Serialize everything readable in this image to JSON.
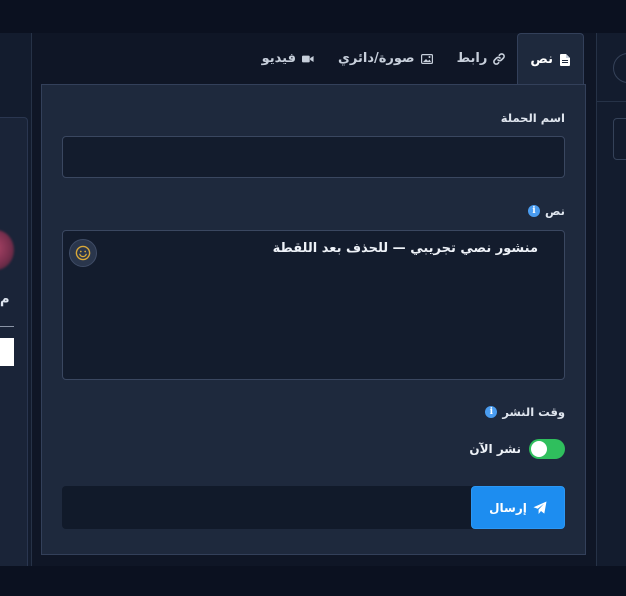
{
  "tabs": [
    {
      "label": "نص",
      "icon": "file-icon",
      "active": true
    },
    {
      "label": "رابط",
      "icon": "link-icon",
      "active": false
    },
    {
      "label": "صورة/دائري",
      "icon": "image-icon",
      "active": false
    },
    {
      "label": "فيديو",
      "icon": "video-icon",
      "active": false
    }
  ],
  "form": {
    "campaign_name_label": "اسم الحملة",
    "campaign_name_value": "",
    "text_label": "نص",
    "text_value": "منشور نصي تجريبي — للحذف بعد اللقطة",
    "publish_time_label": "وقت النشر",
    "publish_now_label": "نشر الآن",
    "publish_now_enabled": true,
    "send_label": "إرسال"
  },
  "left_panel": {
    "partial_letter": "م"
  },
  "colors": {
    "accent": "#1d8df0",
    "toggle_on": "#2fbf5d",
    "info": "#4a9cf0",
    "card_bg": "#1e293d",
    "page_bg": "#0f1626"
  }
}
